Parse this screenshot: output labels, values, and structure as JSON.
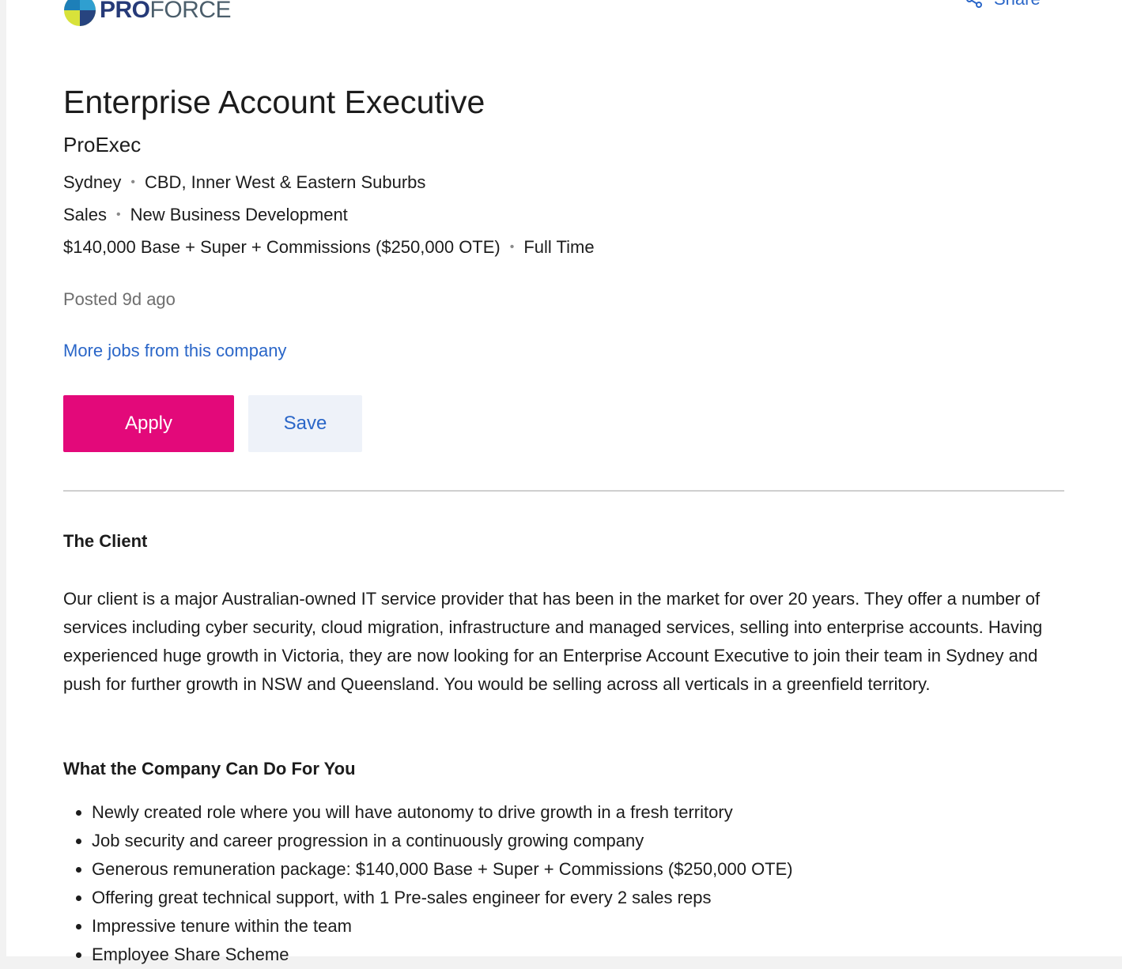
{
  "header": {
    "logo_text_bold": "PRO",
    "logo_text_regular": "FORCE",
    "share_label": "Share",
    "share_icon": "share-icon"
  },
  "job": {
    "title": "Enterprise Account Executive",
    "company": "ProExec",
    "location": {
      "city": "Sydney",
      "area": "CBD, Inner West & Eastern Suburbs"
    },
    "classification": {
      "category": "Sales",
      "subcategory": "New Business Development"
    },
    "pay": {
      "salary": "$140,000 Base + Super + Commissions ($250,000 OTE)",
      "work_type": "Full Time"
    },
    "posted": "Posted 9d ago",
    "more_jobs_link": "More jobs from this company"
  },
  "actions": {
    "apply_label": "Apply",
    "save_label": "Save"
  },
  "colors": {
    "apply_bg": "#e3097a",
    "link": "#2a66c8",
    "save_bg": "#eef2f9"
  },
  "description": {
    "client_heading": "The Client",
    "client_paragraph": "Our client is a major Australian-owned IT service provider that has been in the market for over 20 years. They offer a number of services including cyber security, cloud migration, infrastructure and managed services, selling into enterprise accounts. Having experienced huge growth in Victoria, they are now looking for an Enterprise Account Executive to join their team in Sydney and push for further growth in NSW and Queensland. You would be selling across all verticals in a greenfield territory.",
    "benefits_heading": "What the Company Can Do For You",
    "benefits": [
      "Newly created role where you will have autonomy to drive growth in a fresh territory",
      "Job security and career progression in a continuously growing company",
      "Generous remuneration package: $140,000 Base + Super + Commissions ($250,000 OTE)",
      "Offering great technical support, with 1 Pre-sales engineer for every 2 sales reps",
      "Impressive tenure within the team",
      "Employee Share Scheme"
    ]
  }
}
